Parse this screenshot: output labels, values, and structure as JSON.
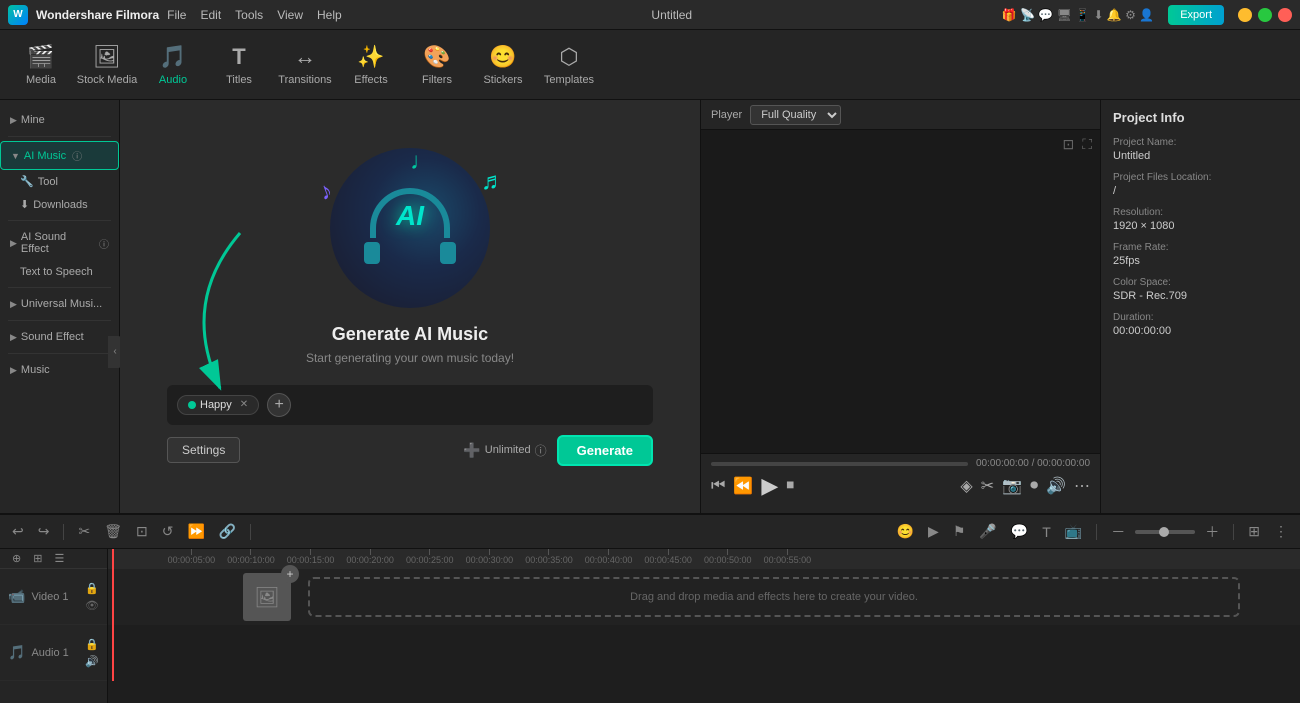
{
  "app": {
    "name": "Wondershare Filmora",
    "title": "Untitled"
  },
  "titlebar": {
    "menu": [
      "File",
      "Edit",
      "Tools",
      "View",
      "Help"
    ],
    "export_label": "Export"
  },
  "toolbar": {
    "items": [
      {
        "id": "media",
        "label": "Media",
        "icon": "🎬"
      },
      {
        "id": "stock-media",
        "label": "Stock Media",
        "icon": "🖼"
      },
      {
        "id": "audio",
        "label": "Audio",
        "icon": "🎵",
        "active": true
      },
      {
        "id": "titles",
        "label": "Titles",
        "icon": "T"
      },
      {
        "id": "transitions",
        "label": "Transitions",
        "icon": "↔"
      },
      {
        "id": "effects",
        "label": "Effects",
        "icon": "✨"
      },
      {
        "id": "filters",
        "label": "Filters",
        "icon": "🎨"
      },
      {
        "id": "stickers",
        "label": "Stickers",
        "icon": "😊"
      },
      {
        "id": "templates",
        "label": "Templates",
        "icon": "⬡"
      }
    ]
  },
  "sidebar": {
    "items": [
      {
        "id": "mine",
        "label": "Mine",
        "type": "section"
      },
      {
        "id": "ai-music",
        "label": "AI Music",
        "active": true,
        "has_info": true
      },
      {
        "id": "tool",
        "label": "Tool",
        "sub": true,
        "icon": "🔧"
      },
      {
        "id": "downloads",
        "label": "Downloads",
        "sub": true,
        "icon": "⬇"
      },
      {
        "id": "ai-sound-effect",
        "label": "AI Sound Effect",
        "type": "section",
        "has_info": true
      },
      {
        "id": "text-to-speech",
        "label": "Text to Speech",
        "sub": true
      },
      {
        "id": "universal-music",
        "label": "Universal Musi...",
        "type": "section"
      },
      {
        "id": "sound-effect",
        "label": "Sound Effect",
        "type": "section"
      },
      {
        "id": "music",
        "label": "Music",
        "type": "section"
      }
    ]
  },
  "ai_music": {
    "title": "Generate AI Music",
    "subtitle": "Start generating your own music today!",
    "tag": "Happy",
    "settings_label": "Settings",
    "unlimited_label": "Unlimited",
    "generate_label": "Generate"
  },
  "player": {
    "label": "Player",
    "quality": "Full Quality",
    "time_current": "00:00:00:00",
    "time_total": "00:00:00:00"
  },
  "project_info": {
    "title": "Project Info",
    "name_label": "Project Name:",
    "name_value": "Untitled",
    "files_label": "Project Files Location:",
    "files_value": "/",
    "resolution_label": "Resolution:",
    "resolution_value": "1920 × 1080",
    "frame_rate_label": "Frame Rate:",
    "frame_rate_value": "25fps",
    "color_space_label": "Color Space:",
    "color_space_value": "SDR - Rec.709",
    "duration_label": "Duration:",
    "duration_value": "00:00:00:00"
  },
  "timeline": {
    "toolbar_buttons": [
      "undo",
      "redo",
      "cut",
      "delete",
      "split",
      "crop",
      "rotate",
      "speed",
      "link"
    ],
    "ruler_marks": [
      "00:00:05:00",
      "00:00:10:00",
      "00:00:15:00",
      "00:00:20:00",
      "00:00:25:00",
      "00:00:30:00",
      "00:00:35:00",
      "00:00:40:00",
      "00:00:45:00",
      "00:00:50:00",
      "00:00:55:00"
    ],
    "track_video": "Video 1",
    "track_audio": "Audio 1",
    "drop_label": "Drag and drop media and effects here to create your video."
  }
}
